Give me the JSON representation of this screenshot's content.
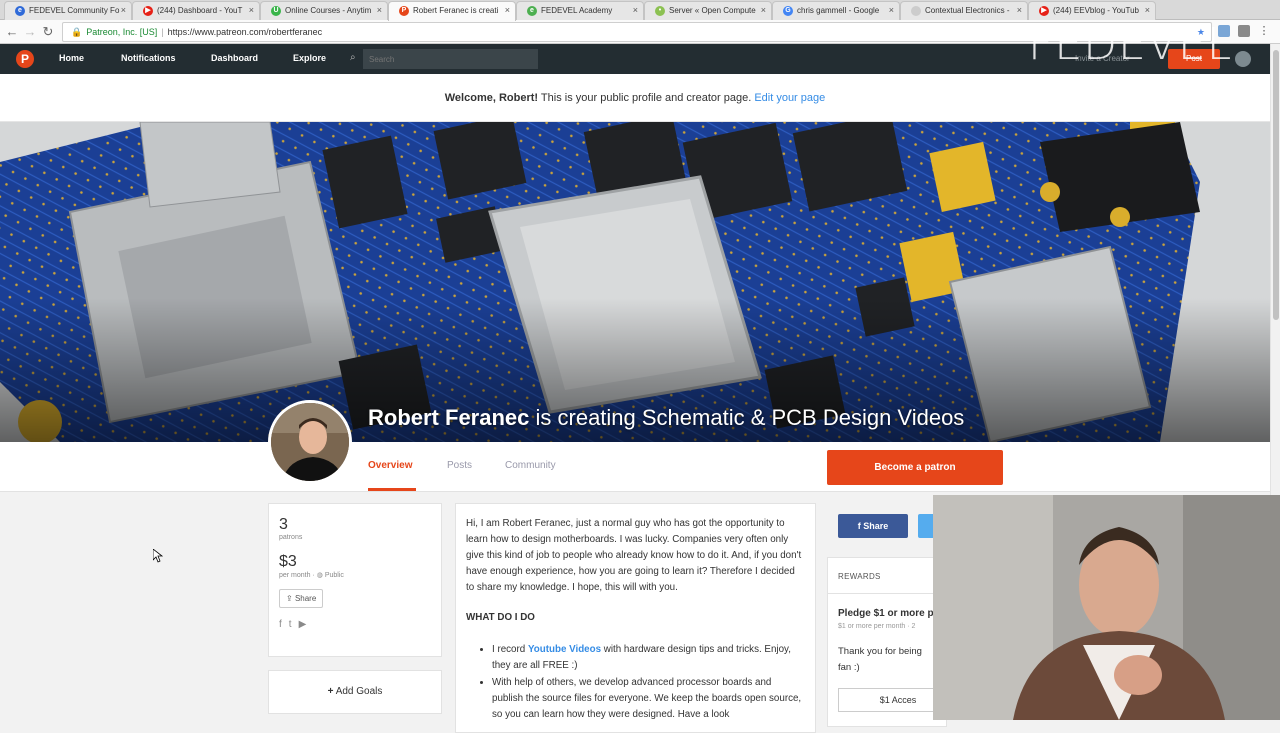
{
  "browser": {
    "tabs": [
      {
        "title": "FEDEVEL Community Fo",
        "icon_color": "#2f6ad8",
        "icon": "edge-icon"
      },
      {
        "title": "(244) Dashboard - YouT",
        "icon_color": "#e62117",
        "icon": "youtube-icon"
      },
      {
        "title": "Online Courses - Anytim",
        "icon_color": "#39b54a",
        "icon": "udemy-icon"
      },
      {
        "title": "Robert Feranec is creati",
        "icon_color": "#e6461a",
        "icon": "patreon-icon"
      },
      {
        "title": "FEDEVEL Academy",
        "icon_color": "#4caf50",
        "icon": "edge-icon"
      },
      {
        "title": "Server « Open Compute",
        "icon_color": "#8cc152",
        "icon": "ocp-icon"
      },
      {
        "title": "chris gammell - Google",
        "icon_color": "#4285f4",
        "icon": "google-icon"
      },
      {
        "title": "Contextual Electronics -",
        "icon_color": "#cccccc",
        "icon": "page-icon"
      },
      {
        "title": "(244) EEVblog - YouTub",
        "icon_color": "#e62117",
        "icon": "youtube-icon"
      }
    ],
    "address": {
      "org": "Patreon, Inc. [US]",
      "url": "https://www.patreon.com/robertferanec"
    }
  },
  "watermark": "FEDEVEL",
  "nav": {
    "items": [
      "Home",
      "Notifications",
      "Dashboard",
      "Explore"
    ],
    "search_placeholder": "Search",
    "invite": "Invite a Creator",
    "post": "Post"
  },
  "welcome": {
    "greeting": "Welcome, Robert!",
    "text": " This is your public profile and creator page. ",
    "link": "Edit your page"
  },
  "creator": {
    "name": "Robert Feranec",
    "tagline": " is creating Schematic & PCB Design Videos"
  },
  "profile_tabs": [
    "Overview",
    "Posts",
    "Community"
  ],
  "become_patron": "Become a patron",
  "stats": {
    "patrons_count": "3",
    "patrons_label": "patrons",
    "amount": "$3",
    "per_month": "per month",
    "visibility": "Public",
    "share": "Share"
  },
  "add_goals": "Add Goals",
  "about": {
    "intro": "Hi, I am Robert Feranec, just a normal guy who has got the opportunity to learn how to design motherboards. I was lucky. Companies very often only give this kind of job to people who already know how to do it. And, if you don't have enough experience, how you are going to learn it? Therefore I decided to share my knowledge. I hope, this will with you.",
    "heading": "WHAT DO I DO",
    "bullet1_pre": "I record ",
    "bullet1_link": "Youtube Videos",
    "bullet1_post": " with hardware design tips and tricks. Enjoy, they are all FREE :)",
    "bullet2": "With help of others, we develop advanced processor boards and publish the source files for everyone. We keep the boards open source, so you can learn how they were designed. Have a look"
  },
  "share_fb": "Share",
  "rewards": {
    "heading": "REWARDS",
    "pledge": "Pledge $1 or more p",
    "per_month": "$1 or more per month · 2",
    "thanks_line1": "Thank you for being",
    "thanks_line2": "fan :)",
    "access": "$1 Acces"
  }
}
